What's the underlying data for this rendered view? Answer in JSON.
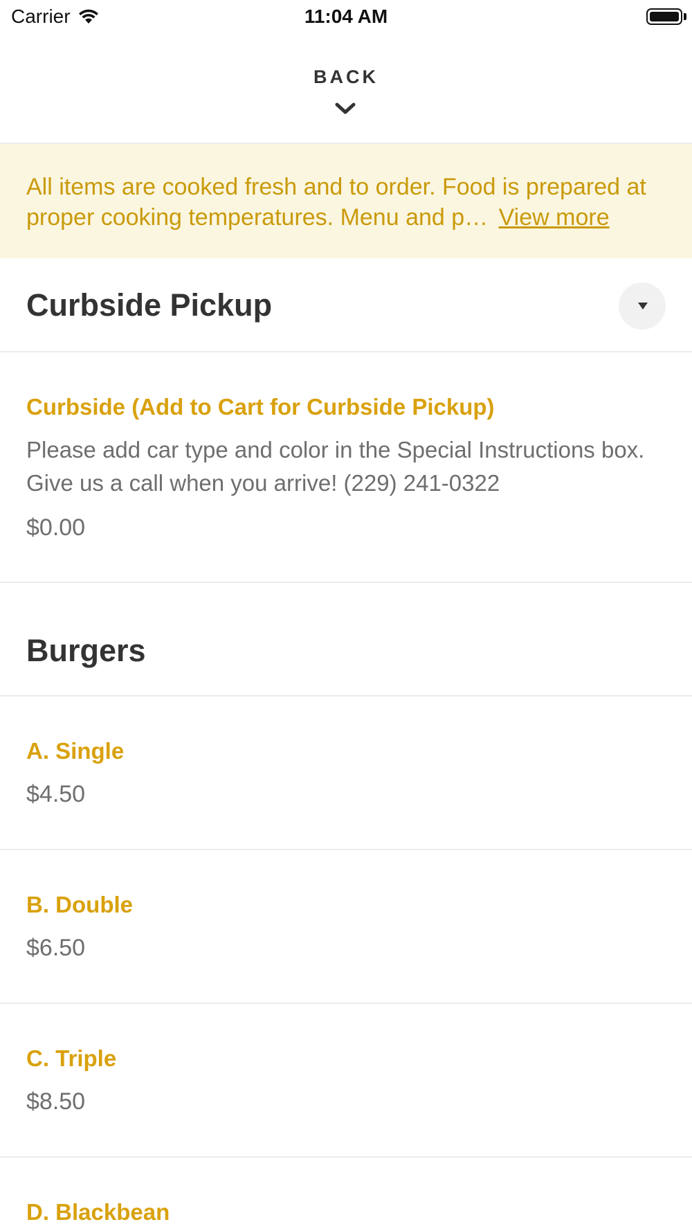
{
  "status_bar": {
    "carrier": "Carrier",
    "time": "11:04 AM",
    "battery_level": 1.0
  },
  "header": {
    "back_label": "BACK"
  },
  "notice": {
    "text": "All items are cooked fresh and to order. Food is prepared at proper cooking temperatures. Menu and p…",
    "view_more_label": "View more"
  },
  "sections": [
    {
      "title": "Curbside Pickup",
      "items": [
        {
          "name": "Curbside (Add to Cart for Curbside Pickup)",
          "description": "Please add car type and color in the Special Instructions box. Give us a call when you arrive! (229) 241-0322",
          "price": "$0.00"
        }
      ]
    },
    {
      "title": "Burgers",
      "items": [
        {
          "name": "A. Single",
          "price": "$4.50"
        },
        {
          "name": "B. Double",
          "price": "$6.50"
        },
        {
          "name": "C. Triple",
          "price": "$8.50"
        },
        {
          "name": "D. Blackbean"
        }
      ]
    }
  ],
  "colors": {
    "accent": "#d9a10d",
    "notice_bg": "#fbf6e0",
    "notice_text": "#c99a0b",
    "text_muted": "#6e6e6e"
  }
}
